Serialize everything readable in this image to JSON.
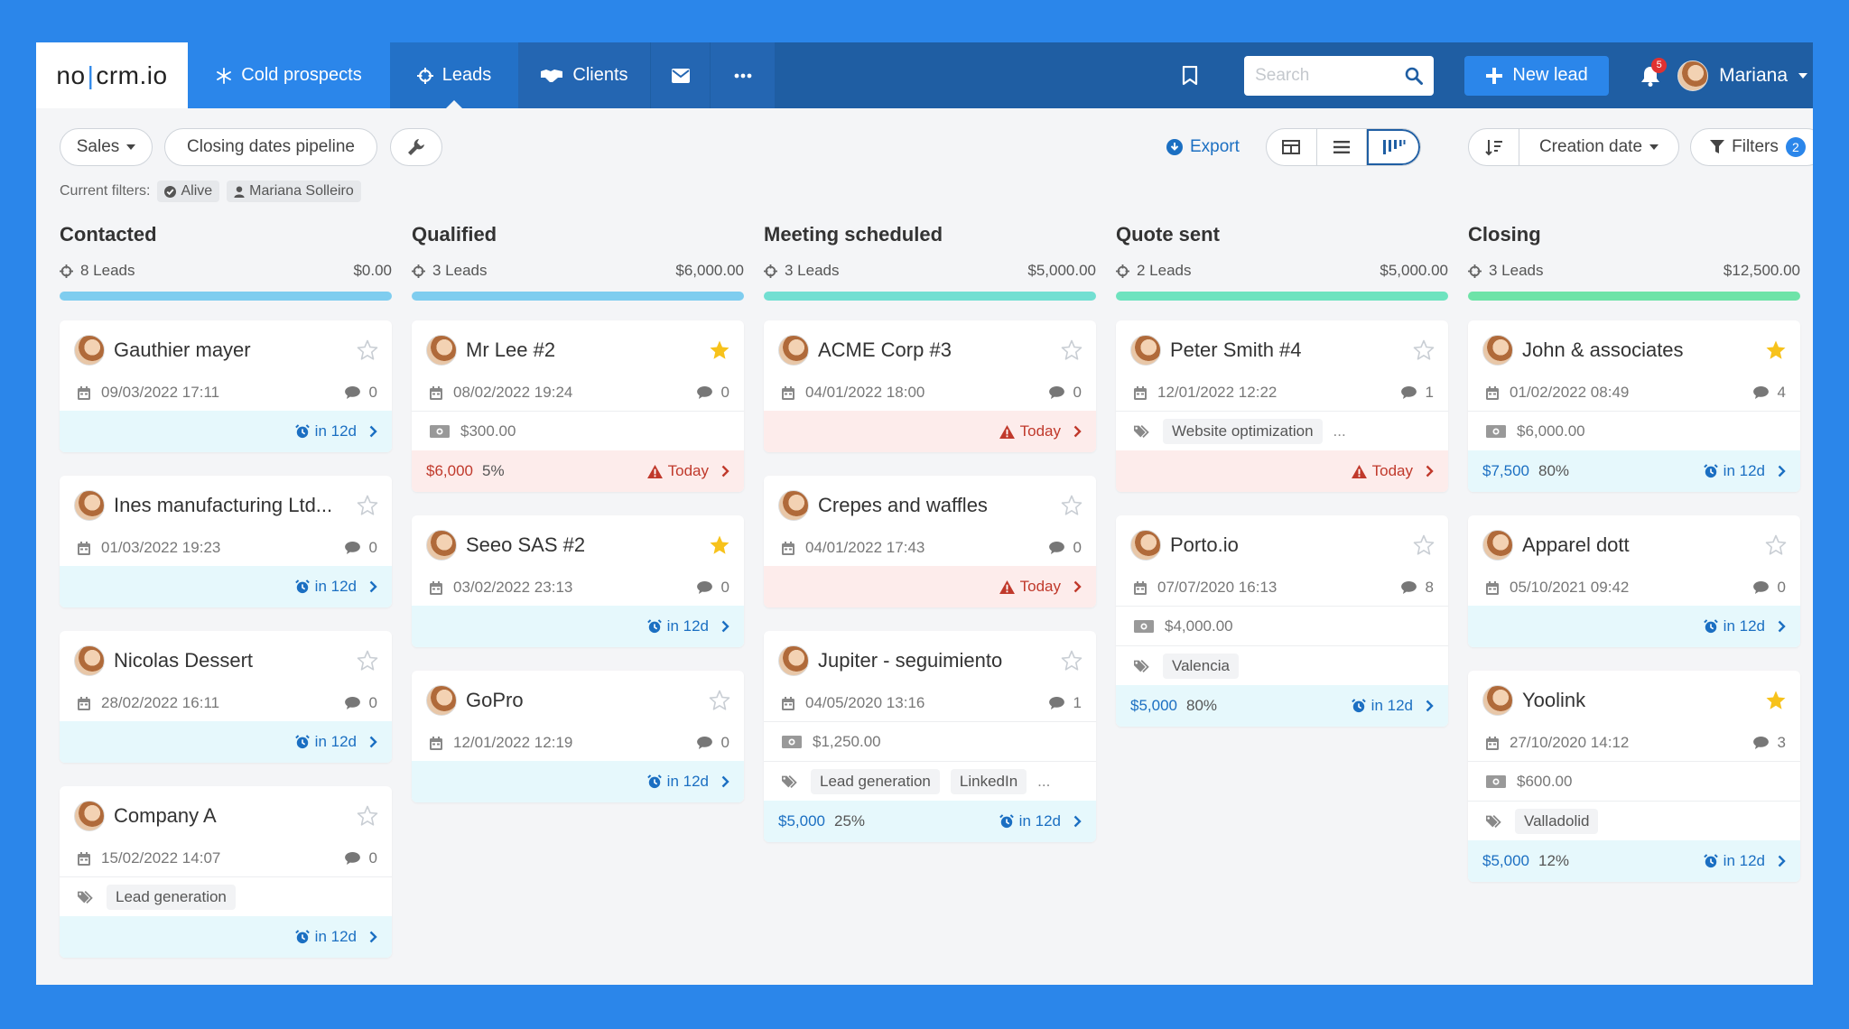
{
  "nav": {
    "logo_left": "no",
    "logo_right": "crm.io",
    "tabs": [
      {
        "label": "Cold prospects"
      },
      {
        "label": "Leads"
      },
      {
        "label": "Clients"
      }
    ],
    "search_placeholder": "Search",
    "new_lead_label": "New lead",
    "notification_count": "5",
    "user_name": "Mariana"
  },
  "toolbar": {
    "pipeline_label": "Sales",
    "view_label": "Closing dates pipeline",
    "export_label": "Export",
    "sort_label": "Creation date",
    "filters_label": "Filters",
    "filters_count": "2"
  },
  "current_filters": {
    "label": "Current filters:",
    "chips": [
      "Alive",
      "Mariana Solleiro"
    ]
  },
  "colors": {
    "accent": "#2b86ea",
    "nav": "#1f5ea3",
    "star_on": "#f7c21b",
    "due_blue": "#1b6fc2",
    "due_red": "#c0392b"
  },
  "columns": [
    {
      "title": "Contacted",
      "count": "8 Leads",
      "total": "$0.00",
      "bar_color": "#7fcdef",
      "cards": [
        {
          "name": "Gauthier mayer",
          "starred": false,
          "date": "09/03/2022 17:11",
          "comments": "0",
          "foot_type": "blue",
          "due": "in 12d"
        },
        {
          "name": "Ines manufacturing Ltd...",
          "starred": false,
          "date": "01/03/2022 19:23",
          "comments": "0",
          "foot_type": "blue",
          "due": "in 12d"
        },
        {
          "name": "Nicolas Dessert",
          "starred": false,
          "date": "28/02/2022 16:11",
          "comments": "0",
          "foot_type": "blue",
          "due": "in 12d"
        },
        {
          "name": "Company A",
          "starred": false,
          "date": "15/02/2022 14:07",
          "comments": "0",
          "tags": [
            "Lead generation"
          ],
          "foot_type": "blue",
          "due": "in 12d"
        }
      ]
    },
    {
      "title": "Qualified",
      "count": "3 Leads",
      "total": "$6,000.00",
      "bar_color": "#7fcdef",
      "cards": [
        {
          "name": "Mr Lee #2",
          "starred": true,
          "date": "08/02/2022 19:24",
          "comments": "0",
          "money": "$300.00",
          "foot_type": "red",
          "amount": "$6,000",
          "pct": "5%",
          "due": "Today"
        },
        {
          "name": "Seeo SAS #2",
          "starred": true,
          "date": "03/02/2022 23:13",
          "comments": "0",
          "foot_type": "blue",
          "due": "in 12d"
        },
        {
          "name": "GoPro",
          "starred": false,
          "date": "12/01/2022 12:19",
          "comments": "0",
          "foot_type": "blue",
          "due": "in 12d"
        }
      ]
    },
    {
      "title": "Meeting scheduled",
      "count": "3 Leads",
      "total": "$5,000.00",
      "bar_color": "#72dfd2",
      "cards": [
        {
          "name": "ACME Corp #3",
          "starred": false,
          "date": "04/01/2022 18:00",
          "comments": "0",
          "foot_type": "red",
          "due": "Today"
        },
        {
          "name": "Crepes and waffles",
          "starred": false,
          "date": "04/01/2022 17:43",
          "comments": "0",
          "foot_type": "red",
          "due": "Today"
        },
        {
          "name": "Jupiter - seguimiento",
          "starred": false,
          "date": "04/05/2020 13:16",
          "comments": "1",
          "money": "$1,250.00",
          "tags": [
            "Lead generation",
            "LinkedIn"
          ],
          "more": "...",
          "foot_type": "blue",
          "amount": "$5,000",
          "pct": "25%",
          "due": "in 12d"
        }
      ]
    },
    {
      "title": "Quote sent",
      "count": "2 Leads",
      "total": "$5,000.00",
      "bar_color": "#6ee3bf",
      "cards": [
        {
          "name": "Peter Smith #4",
          "starred": false,
          "date": "12/01/2022 12:22",
          "comments": "1",
          "tags": [
            "Website optimization"
          ],
          "more": "...",
          "foot_type": "red",
          "due": "Today"
        },
        {
          "name": "Porto.io",
          "starred": false,
          "date": "07/07/2020 16:13",
          "comments": "8",
          "money": "$4,000.00",
          "tags": [
            "Valencia"
          ],
          "foot_type": "blue",
          "amount": "$5,000",
          "pct": "80%",
          "due": "in 12d"
        }
      ]
    },
    {
      "title": "Closing",
      "count": "3 Leads",
      "total": "$12,500.00",
      "bar_color": "#6ee3a8",
      "cards": [
        {
          "name": "John & associates",
          "starred": true,
          "date": "01/02/2022 08:49",
          "comments": "4",
          "money": "$6,000.00",
          "foot_type": "blue",
          "amount": "$7,500",
          "pct": "80%",
          "due": "in 12d"
        },
        {
          "name": "Apparel dott",
          "starred": false,
          "date": "05/10/2021 09:42",
          "comments": "0",
          "foot_type": "blue",
          "due": "in 12d"
        },
        {
          "name": "Yoolink",
          "starred": true,
          "date": "27/10/2020 14:12",
          "comments": "3",
          "money": "$600.00",
          "tags": [
            "Valladolid"
          ],
          "foot_type": "blue",
          "amount": "$5,000",
          "pct": "12%",
          "due": "in 12d"
        }
      ]
    }
  ]
}
